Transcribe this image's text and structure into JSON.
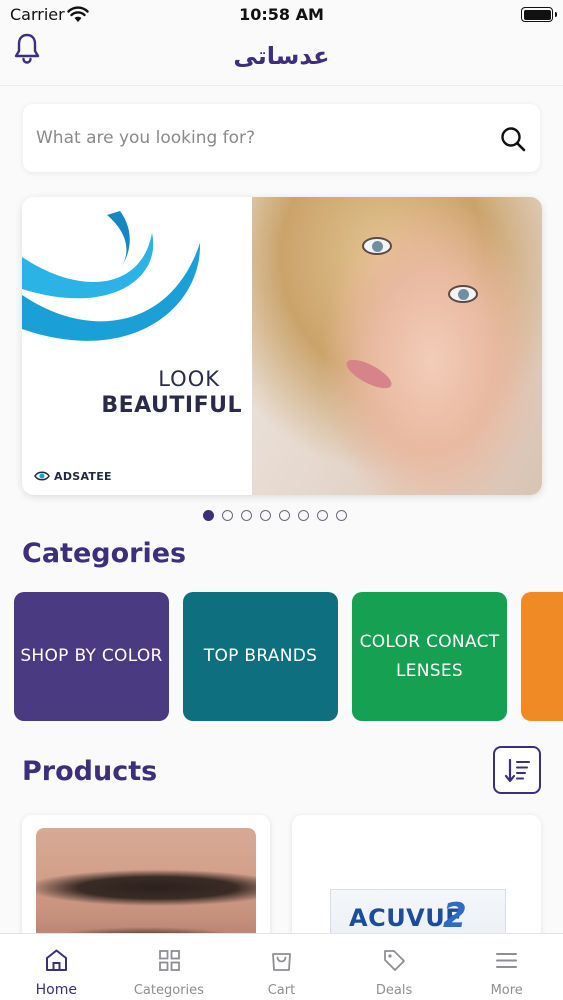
{
  "status_bar": {
    "carrier": "Carrier",
    "time": "10:58 AM"
  },
  "header": {
    "brand": "عدساتی"
  },
  "search": {
    "placeholder": "What are you looking for?"
  },
  "banner": {
    "line1": "LOOK",
    "line2": "BEAUTIFUL",
    "logo_text": "ADSATEE",
    "slide_count": 8,
    "active_slide": 1
  },
  "categories": {
    "title": "Categories",
    "items": [
      {
        "label": "SHOP BY COLOR",
        "color": "#4a3a82"
      },
      {
        "label": "TOP BRANDS",
        "color": "#0e6f7e"
      },
      {
        "label": "COLOR CONACT LENSES",
        "color": "#16a051"
      },
      {
        "label": "",
        "color": "#f08a24"
      }
    ]
  },
  "products": {
    "title": "Products",
    "items": [
      {
        "brand_text": "ACUVUE",
        "brand_suffix": "2"
      }
    ]
  },
  "tab_bar": {
    "items": [
      {
        "label": "Home",
        "icon": "home-icon",
        "active": true
      },
      {
        "label": "Categories",
        "icon": "grid-icon",
        "active": false
      },
      {
        "label": "Cart",
        "icon": "cart-icon",
        "active": false
      },
      {
        "label": "Deals",
        "icon": "tag-icon",
        "active": false
      },
      {
        "label": "More",
        "icon": "menu-icon",
        "active": false
      }
    ]
  },
  "colors": {
    "primary": "#3d2f7c",
    "inactive_tab": "#8e8e93",
    "banner_wave": "#1a9fd6"
  }
}
